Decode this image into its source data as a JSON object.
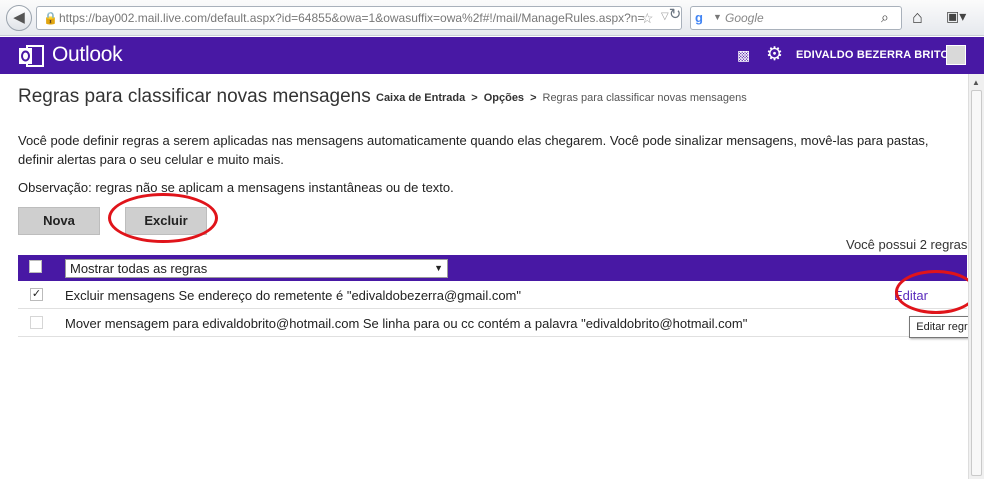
{
  "browser": {
    "url": "https://bay002.mail.live.com/default.aspx?id=64855&owa=1&owasuffix=owa%2f#!/mail/ManageRules.aspx?n=",
    "search_placeholder": "Google"
  },
  "header": {
    "app_name": "Outlook",
    "user_name": "EDIVALDO BEZERRA BRITO",
    "accent_color": "#4818a4"
  },
  "page": {
    "title": "Regras para classificar novas mensagens",
    "breadcrumb": {
      "inbox": "Caixa de Entrada",
      "options": "Opções",
      "current": "Regras para classificar novas mensagens"
    },
    "intro": "Você pode definir regras a serem aplicadas nas mensagens automaticamente quando elas chegarem. Você pode sinalizar mensagens, movê-las para pastas, definir alertas para o seu celular e muito mais.",
    "note": "Observação: regras não se aplicam a mensagens instantâneas ou de texto.",
    "buttons": {
      "new_label": "Nova",
      "delete_label": "Excluir"
    },
    "rules_count": "Você possui 2 regras",
    "filter": {
      "selected": "Mostrar todas as regras"
    },
    "rules": [
      {
        "checked": true,
        "text": "Excluir mensagens Se endereço do remetente é \"edivaldobezerra@gmail.com\"",
        "edit_label": "Editar"
      },
      {
        "checked": false,
        "text": "Mover mensagem para edivaldobrito@hotmail.com Se linha para ou cc contém a palavra \"edivaldobrito@hotmail.com\""
      }
    ],
    "tooltip": "Editar regra"
  }
}
